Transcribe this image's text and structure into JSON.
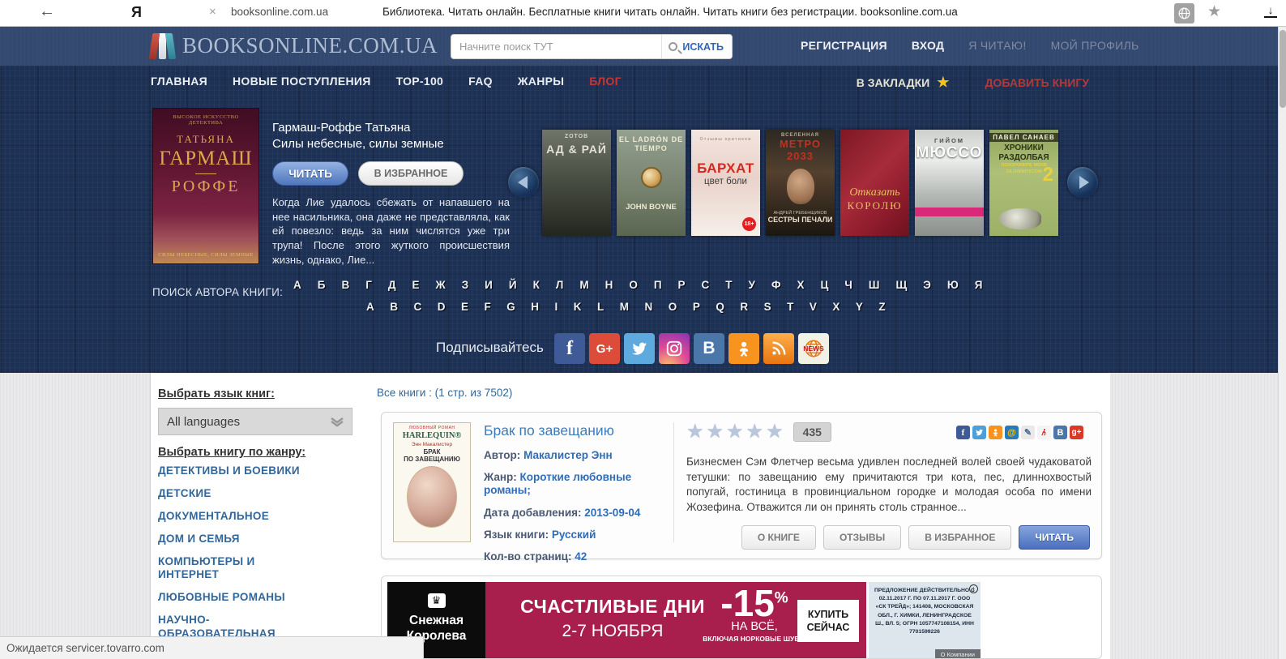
{
  "colors": {
    "header_bg": "#33496f",
    "hero_bg": "#1d3155",
    "accent_red": "#c93535",
    "link_blue": "#2f6db8",
    "genre_blue": "#336699",
    "ad_magenta": "#a81e4c",
    "star_gold": "#f2c21d"
  },
  "browser": {
    "back_icon": "←",
    "ya_logo": "Я",
    "close_icon": "×",
    "url": "booksonline.com.ua",
    "title": "Библиотека. Читать онлайн. Бесплатные книги читать онлайн. Читать книги без регистрации. booksonline.com.ua"
  },
  "header": {
    "logo_text": "BOOKSONLINE.COM.UA",
    "search_placeholder": "Начните поиск ТУТ",
    "search_button": "ИСКАТЬ",
    "registration": "РЕГИСТРАЦИЯ",
    "login": "ВХОД",
    "reading": "Я ЧИТАЮ!",
    "profile": "МОЙ ПРОФИЛЬ"
  },
  "nav": {
    "items": [
      "ГЛАВНАЯ",
      "НОВЫЕ ПОСТУПЛЕНИЯ",
      "ТОР-100",
      "FAQ",
      "ЖАНРЫ",
      "БЛОГ"
    ],
    "bookmarks": "В ЗАКЛАДКИ",
    "add_book": "ДОБАВИТЬ КНИГУ"
  },
  "featured": {
    "author": "Гармаш-Роффе Татьяна",
    "title": "Силы небесные, силы земные",
    "read_btn": "ЧИТАТЬ",
    "fav_btn": "В ИЗБРАННОЕ",
    "description": "Когда Лие удалось сбежать от напавшего на нее насильника, она даже не представляла, как ей повезло: ведь за ним числятся уже три трупа! После этого жуткого происшествия жизнь, однако, Лие...",
    "cover": {
      "tagline": "ВЫСОКОЕ ИСКУССТВО ДЕТЕКТИВА",
      "line1": "ТАТЬЯНА",
      "line2": "ГАРМАШ",
      "line3": "РОФФЕ",
      "bottom": "СИЛЫ НЕБЕСНЫЕ, СИЛЫ ЗЕМНЫЕ"
    }
  },
  "carousel": {
    "covers": [
      {
        "top": "ZOTOB",
        "title": "АД & РАЙ"
      },
      {
        "top": "EL LADRÓN DE TIEMPO",
        "bottom": "JOHN BOYNE"
      },
      {
        "lines": "Отзывы критиков",
        "title": "БАРХАТ",
        "subtitle": "цвет боли",
        "badge": "18+"
      },
      {
        "top": "ВСЕЛЕННАЯ",
        "title": "МЕТРО 2033",
        "author": "АНДРЕЙ ГРЕБЕНЩИКОВ",
        "bottom": "СЕСТРЫ ПЕЧАЛИ"
      },
      {
        "title": "Отказать",
        "subtitle": "КОРОЛЮ"
      },
      {
        "top": "ГИЙОМ",
        "title": "МЮССО"
      },
      {
        "top": "ПАВЕЛ САНАЕВ",
        "title": "ХРОНИКИ РАЗДОЛБАЯ",
        "subtitle": "ПОХОРОНИТЕ МЕНЯ\nЗА ПЛИНТУСОМ",
        "badge": "2"
      }
    ]
  },
  "author_search": {
    "label": "ПОИСК АВТОРА КНИГИ:",
    "cyrillic": [
      "А",
      "Б",
      "В",
      "Г",
      "Д",
      "Е",
      "Ж",
      "З",
      "И",
      "Й",
      "К",
      "Л",
      "М",
      "Н",
      "О",
      "П",
      "Р",
      "С",
      "Т",
      "У",
      "Ф",
      "Х",
      "Ц",
      "Ч",
      "Ш",
      "Щ",
      "Э",
      "Ю",
      "Я"
    ],
    "latin": [
      "A",
      "B",
      "C",
      "D",
      "E",
      "F",
      "G",
      "H",
      "I",
      "K",
      "L",
      "M",
      "N",
      "O",
      "P",
      "Q",
      "R",
      "S",
      "T",
      "V",
      "X",
      "Y",
      "Z"
    ]
  },
  "social": {
    "label": "Подписывайтесь",
    "news_glyph": "NEWS",
    "icons": [
      "facebook",
      "google-plus",
      "twitter",
      "instagram",
      "vkontakte",
      "odnoklassniki",
      "rss",
      "news"
    ]
  },
  "sidebar": {
    "language_label": "Выбрать язык книг:",
    "language_value": "All languages",
    "genre_label": "Выбрать книгу по жанру:",
    "genres": [
      "ДЕТЕКТИВЫ И БОЕВИКИ",
      "ДЕТСКИЕ",
      "ДОКУМЕНТАЛЬНОЕ",
      "ДОМ И СЕМЬЯ",
      "КОМПЬЮТЕРЫ И\nИНТЕРНЕТ",
      "ЛЮБОВНЫЕ РОМАНЫ",
      "НАУЧНО-\nОБРАЗОВАТЕЛЬНАЯ"
    ]
  },
  "main": {
    "all_books": "Все книги : (1 стр. из 7502)",
    "book": {
      "title": "Брак по завещанию",
      "fields": [
        {
          "label": "Автор:",
          "value": "Макалистер Энн"
        },
        {
          "label": "Жанр:",
          "value": "Короткие любовные романы;"
        },
        {
          "label": "Дата добавления:",
          "value": "2013-09-04"
        },
        {
          "label": "Язык книги:",
          "value": "Русский"
        },
        {
          "label": "Кол-во страниц:",
          "value": "42"
        }
      ],
      "rating_count": "435",
      "description": "Бизнесмен Сэм Флетчер весьма удивлен последней волей своей чудаковатой тетушки: по завещанию ему причитаются три кота, пес, длиннохвостый попугай, гостиница в провинциальном городке и молодая особа по имени Жозефина. Отважится ли он принять столь странное...",
      "buttons": [
        "О КНИГЕ",
        "ОТЗЫВЫ",
        "В ИЗБРАННОЕ",
        "ЧИТАТЬ"
      ],
      "cover": {
        "top": "ЛЮБОВНЫЙ РОМАН",
        "brand": "HARLEQUIN®",
        "author": "Энн Макалистер",
        "line1": "БРАК",
        "line2": "ПО ЗАВЕЩАНИЮ"
      },
      "share_icons": [
        "facebook",
        "twitter",
        "odnoklassniki",
        "mail-ru",
        "livejournal",
        "liveinternet",
        "vkontakte",
        "google-plus"
      ]
    }
  },
  "ad": {
    "brand_line1": "Снежная",
    "brand_line2": "Королева",
    "promo_line1": "СЧАСТЛИВЫЕ ДНИ",
    "promo_line2": "2-7 НОЯБРЯ",
    "discount": "-15",
    "percent": "%",
    "sub1": "НА ВСЁ,",
    "sub2": "ВКЛЮЧАЯ НОРКОВЫЕ ШУБЫ",
    "buy_line1": "КУПИТЬ",
    "buy_line2": "СЕЙЧАС",
    "legal": "ПРЕДЛОЖЕНИЕ ДЕЙСТВИТЕЛЬНО С 02.11.2017 Г. ПО 07.11.2017 Г. ООО «СК ТРЕЙД»; 141408, МОСКОВСКАЯ ОБЛ., Г. ХИМКИ, ЛЕНИНГРАДСКОЕ Ш., ВЛ. 5; ОГРН 1057747108154, ИНН 7701599226",
    "info_glyph": "i",
    "about": "О Компании"
  },
  "statusbar": {
    "text": "Ожидается servicer.tovarro.com"
  }
}
